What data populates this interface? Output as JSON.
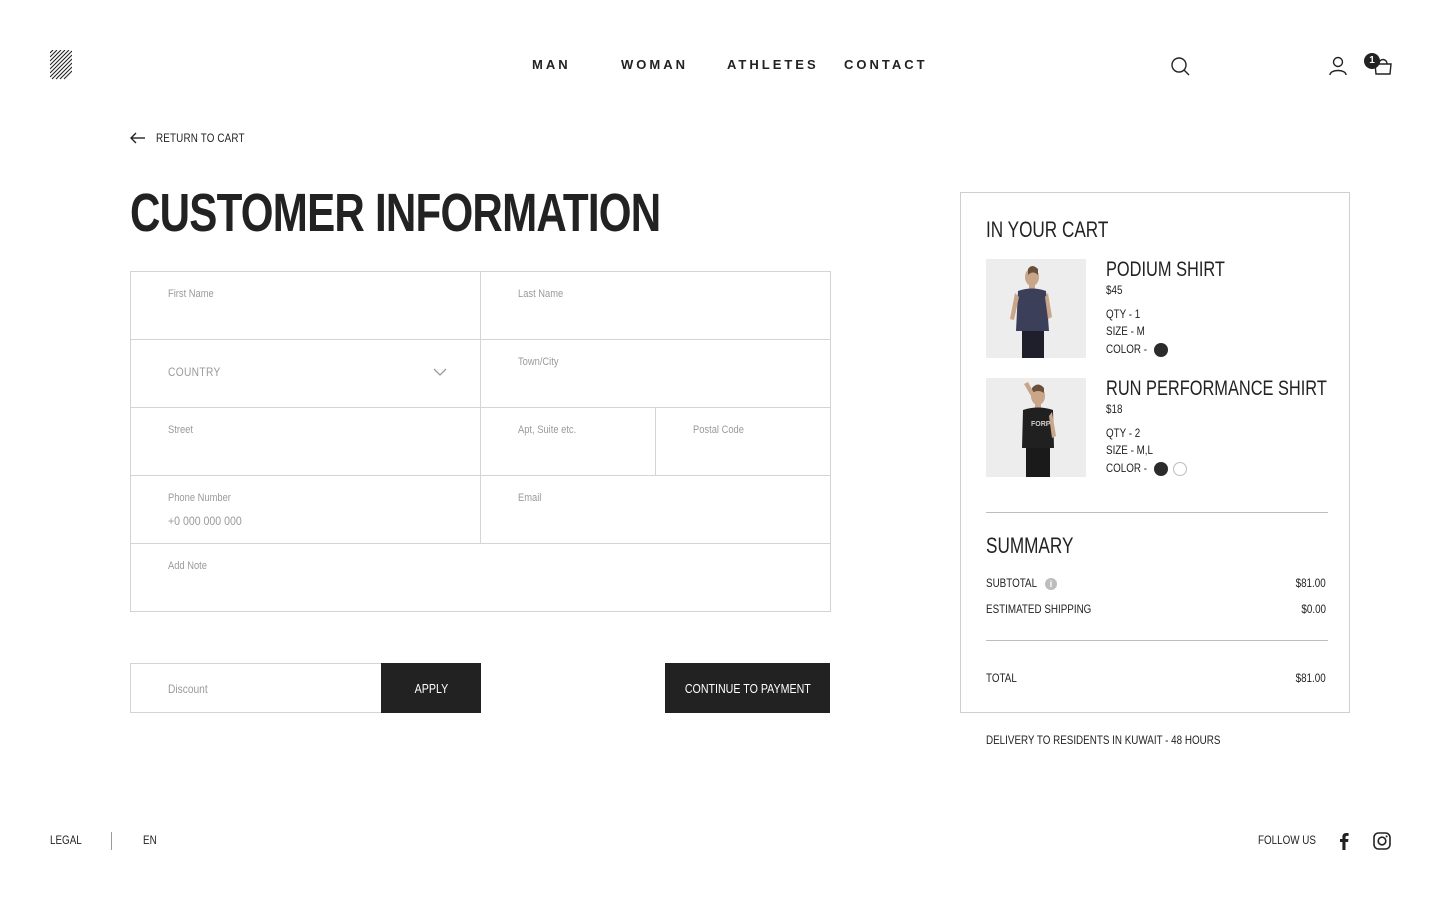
{
  "header": {
    "nav": [
      "MAN",
      "WOMAN",
      "ATHLETES",
      "CONTACT"
    ],
    "cart_count": "1",
    "icons": [
      "logo-icon",
      "search-icon",
      "user-icon",
      "cart-icon"
    ]
  },
  "checkout": {
    "return_label": "RETURN TO CART",
    "title": "CUSTOMER INFORMATION",
    "fields": {
      "first_name": "First Name",
      "last_name": "Last Name",
      "country": "COUNTRY",
      "city": "Town/City",
      "street": "Street",
      "apt": "Apt, Suite etc.",
      "postal": "Postal Code",
      "phone": "Phone Number",
      "phone_placeholder": "+0 000 000 000",
      "email": "Email",
      "note": "Add Note"
    },
    "discount_placeholder": "Discount",
    "apply_label": "APPLY",
    "continue_label": "CONTINUE TO PAYMENT"
  },
  "cart": {
    "title": "IN YOUR CART",
    "items": [
      {
        "name": "PODIUM SHIRT",
        "price": "$45",
        "qty": "QTY  - 1",
        "size": "SIZE  - M",
        "color_label": "COLOR  -",
        "colors": [
          "#2b2b2b"
        ]
      },
      {
        "name": "RUN PERFORMANCE SHIRT",
        "price": "$18",
        "qty": "QTY  - 2",
        "size": "SIZE  - M,L",
        "color_label": "COLOR  -",
        "colors": [
          "#2b2b2b",
          "#ffffff"
        ]
      }
    ],
    "summary": {
      "title": "SUMMARY",
      "subtotal_label": "SUBTOTAL",
      "subtotal": "$81.00",
      "shipping_label": "ESTIMATED SHIPPING",
      "shipping": "$0.00",
      "total_label": "TOTAL",
      "total": "$81.00"
    },
    "delivery_note": "DELIVERY TO RESIDENTS IN KUWAIT - 48 HOURS"
  },
  "footer": {
    "legal": "LEGAL",
    "language": "EN",
    "follow": "FOLLOW US"
  },
  "colors": {
    "primary": "#222222",
    "border": "#d4d4d4",
    "muted": "#9a9a9a"
  }
}
